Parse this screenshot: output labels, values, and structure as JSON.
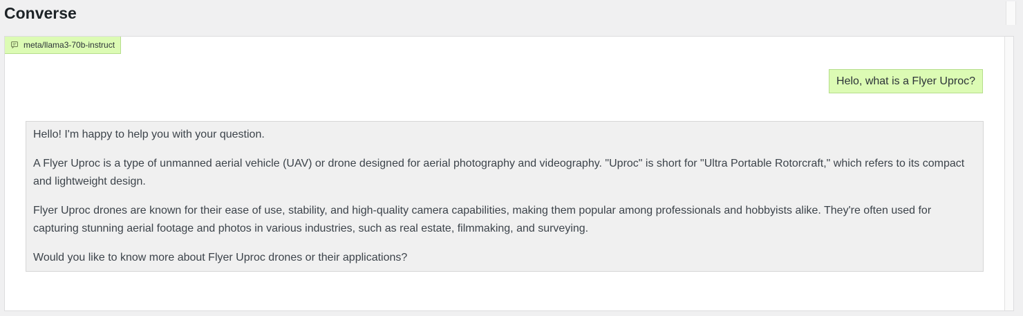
{
  "page": {
    "title": "Converse"
  },
  "model_tag": {
    "icon": "chat-bubble-icon",
    "label": "meta/llama3-70b-instruct"
  },
  "messages": {
    "user": "Helo, what is a Flyer Uproc?",
    "assistant": {
      "paragraphs": [
        "Hello! I'm happy to help you with your question.",
        "A Flyer Uproc is a type of unmanned aerial vehicle (UAV) or drone designed for aerial photography and videography. \"Uproc\" is short for \"Ultra Portable Rotorcraft,\" which refers to its compact and lightweight design.",
        "Flyer Uproc drones are known for their ease of use, stability, and high-quality camera capabilities, making them popular among professionals and hobbyists alike. They're often used for capturing stunning aerial footage and photos in various industries, such as real estate, filmmaking, and surveying.",
        "Would you like to know more about Flyer Uproc drones or their applications?"
      ]
    }
  },
  "colors": {
    "user_bubble_bg": "#dcfbb4",
    "user_bubble_border": "#b5dd8b",
    "assistant_bubble_bg": "#f0f0f0",
    "page_bg": "#f0f0f1"
  }
}
